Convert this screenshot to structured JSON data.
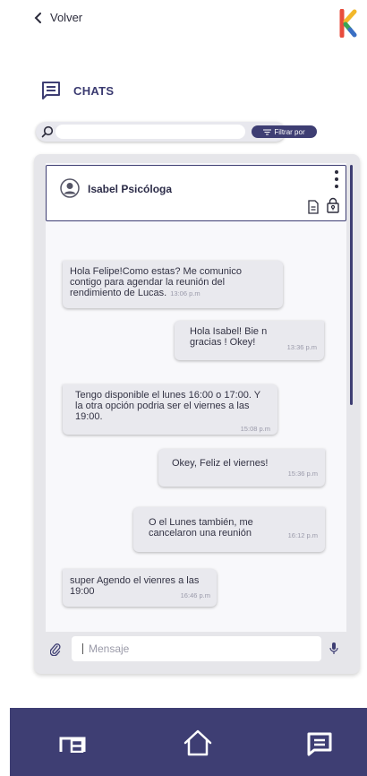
{
  "header": {
    "back_label": "Volver"
  },
  "section": {
    "title": "CHATS"
  },
  "search": {
    "value": "",
    "placeholder": "",
    "filter_label": "Filtrar por"
  },
  "contact": {
    "name": "Isabel Psicóloga"
  },
  "messages": [
    {
      "direction": "in",
      "text": "Hola Felipe!Como estas?  Me comunico contigo para agendar la reunión del rendimiento de Lucas.",
      "time": "13:06 p.m"
    },
    {
      "direction": "out",
      "text": "Hola Isabel! Bie n gracias ! Okey!",
      "time": "13:36 p.m"
    },
    {
      "direction": "in",
      "text": "Tengo disponible el lunes 16:00 o 17:00. Y la otra opción podria ser el viernes a las 19:00.",
      "time": "15:08 p.m"
    },
    {
      "direction": "out",
      "text": "Okey, Feliz el viernes!",
      "time": "15:36 p.m"
    },
    {
      "direction": "out",
      "text": "O el Lunes también, me cancelaron una reunión",
      "time": "16:12 p.m"
    },
    {
      "direction": "in",
      "text": "super Agendo el vienres a las 19:00",
      "time": "16:46 p.m"
    }
  ],
  "composer": {
    "placeholder": "Mensaje"
  },
  "icons": {
    "back": "chevron-left-icon",
    "logo": "brand-logo",
    "section": "chat-icon",
    "search": "search-icon",
    "filter": "filter-icon",
    "avatar": "user-avatar-icon",
    "menu": "kebab-menu-icon",
    "document": "document-icon",
    "lock": "lock-icon",
    "attach": "paperclip-icon",
    "mic": "microphone-icon",
    "nav": [
      "desk-icon",
      "home-icon",
      "chat-icon"
    ]
  },
  "colors": {
    "primary": "#3e3e73",
    "panel": "#e6e6ea",
    "bubble": "#e9e9ee",
    "logo_red": "#e84d3d",
    "logo_yellow": "#f2b72a",
    "logo_green": "#3aa457",
    "logo_blue": "#3a6fc4"
  }
}
